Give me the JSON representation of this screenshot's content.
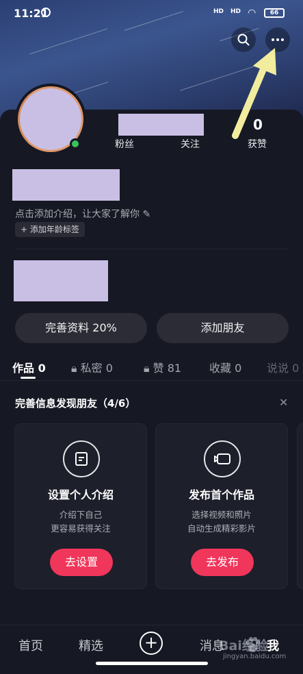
{
  "status_bar": {
    "time": "11:21",
    "signal_1": "HD",
    "signal_2": "HD",
    "battery": "66"
  },
  "header": {
    "search_icon": "search-icon",
    "more_icon": "more-dots-icon"
  },
  "profile": {
    "stats": [
      {
        "label": "粉丝"
      },
      {
        "label": "关注"
      },
      {
        "value": "0",
        "label": "获赞"
      }
    ],
    "intro_placeholder": "点击添加介绍，让大家了解你",
    "age_tag": "添加年龄标签"
  },
  "actions": {
    "complete_profile": "完善资料 20%",
    "add_friend": "添加朋友"
  },
  "tabs": [
    {
      "label": "作品",
      "count": "0",
      "active": true
    },
    {
      "label": "私密",
      "count": "0",
      "locked": true
    },
    {
      "label": "赞",
      "count": "81",
      "locked": true
    },
    {
      "label": "收藏",
      "count": "0"
    },
    {
      "label": "说说",
      "count": "0"
    }
  ],
  "discover": {
    "title": "完善信息发现朋友（4/6）",
    "cards": [
      {
        "icon": "document-icon",
        "title": "设置个人介绍",
        "line1": "介绍下自己",
        "line2": "更容易获得关注",
        "button": "去设置"
      },
      {
        "icon": "video-camera-icon",
        "title": "发布首个作品",
        "line1": "选择视频和照片",
        "line2": "自动生成精彩影片",
        "button": "去发布"
      }
    ]
  },
  "bottom_nav": {
    "home": "首页",
    "featured": "精选",
    "messages": "消息",
    "me": "我"
  },
  "watermark": {
    "text": "Bai经验",
    "url": "jingyan.baidu.com"
  },
  "colors": {
    "background": "#161823",
    "accent": "#f1365b",
    "online": "#38c45a",
    "arrow": "#f2ec9e",
    "redaction": "#c9bfe4"
  }
}
